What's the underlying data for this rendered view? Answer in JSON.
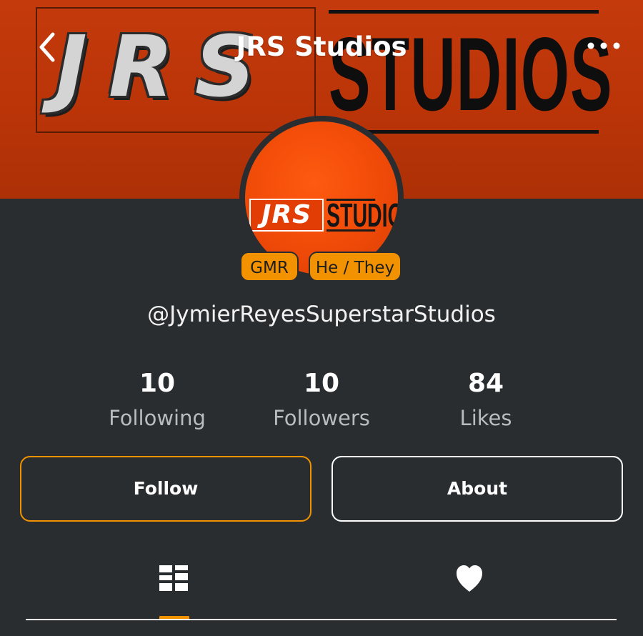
{
  "header": {
    "title": "JRS Studios",
    "back_icon": "chevron-left-icon",
    "more_icon": "more-horizontal-icon"
  },
  "banner": {
    "letters": "JRS",
    "studios": "STUDIOS"
  },
  "avatar": {
    "logo_left": "JRS",
    "logo_right": "STUDIO"
  },
  "badges": [
    "GMR",
    "He / They"
  ],
  "profile": {
    "handle": "@JymierReyesSuperstarStudios"
  },
  "stats": [
    {
      "value": "10",
      "label": "Following"
    },
    {
      "value": "10",
      "label": "Followers"
    },
    {
      "value": "84",
      "label": "Likes"
    }
  ],
  "actions": {
    "follow_label": "Follow",
    "about_label": "About"
  },
  "tabs": [
    {
      "icon": "grid-layout-icon",
      "selected": true
    },
    {
      "icon": "heart-icon",
      "selected": false
    }
  ],
  "colors": {
    "accent": "#f39200",
    "banner": "#bf380a",
    "background": "#2a2d30"
  }
}
